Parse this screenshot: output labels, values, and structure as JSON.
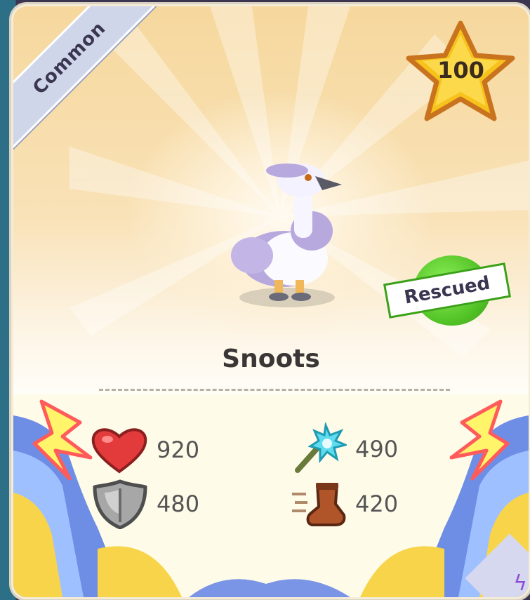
{
  "card": {
    "rarity": "Common",
    "star_value": "100",
    "status_badge": "Rescued",
    "pet_name": "Snoots"
  },
  "stats": [
    {
      "name": "health",
      "icon": "heart-icon",
      "value": "920"
    },
    {
      "name": "power",
      "icon": "wand-icon",
      "value": "490"
    },
    {
      "name": "defense",
      "icon": "shield-icon",
      "value": "480"
    },
    {
      "name": "speed",
      "icon": "boot-icon",
      "value": "420"
    }
  ],
  "colors": {
    "rarity_ribbon": "#cfd6ea",
    "star": "#f6c21b",
    "rescued_badge": "#54c427",
    "stats_background": "#fffbe9"
  }
}
